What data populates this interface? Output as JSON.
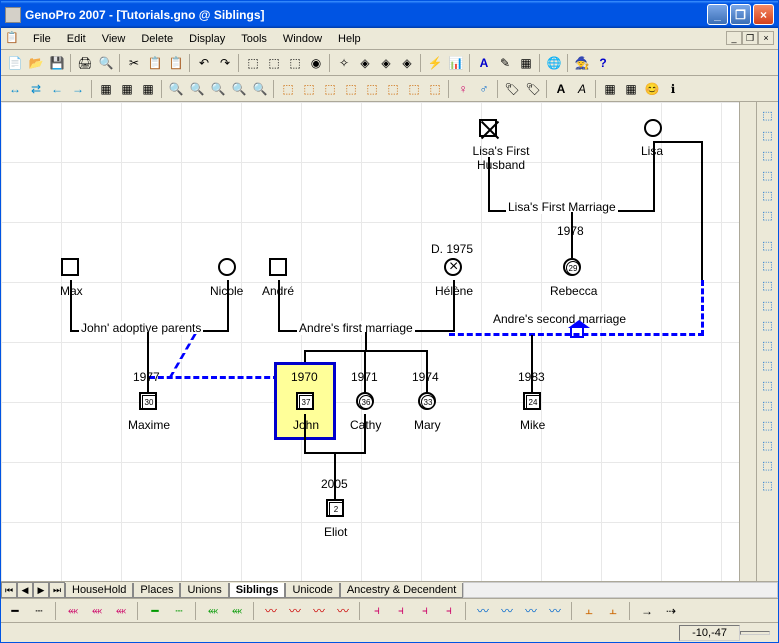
{
  "title": "GenoPro 2007 - [Tutorials.gno @ Siblings]",
  "menu": [
    "File",
    "Edit",
    "View",
    "Delete",
    "Display",
    "Tools",
    "Window",
    "Help"
  ],
  "tabs": {
    "items": [
      "HouseHold",
      "Places",
      "Unions",
      "Siblings",
      "Unicode",
      "Ancestry & Decendent"
    ],
    "active": 3
  },
  "status": {
    "coords": "-10,-47"
  },
  "people": {
    "lisasFirstHusband": {
      "label": "Lisa's First\nHusband"
    },
    "lisa": {
      "label": "Lisa"
    },
    "max": {
      "label": "Max"
    },
    "nicole": {
      "label": "Nicole"
    },
    "andre": {
      "label": "André"
    },
    "helene": {
      "label": "Hélène",
      "death": "D. 1975"
    },
    "rebecca": {
      "label": "Rebecca",
      "age": "29"
    },
    "maxime": {
      "label": "Maxime",
      "age": "30",
      "year": "1977"
    },
    "john": {
      "label": "John",
      "age": "37",
      "year": "1970"
    },
    "cathy": {
      "label": "Cathy",
      "age": "36",
      "year": "1971"
    },
    "mary": {
      "label": "Mary",
      "age": "33",
      "year": "1974"
    },
    "mike": {
      "label": "Mike",
      "age": "24",
      "year": "1983"
    },
    "eliot": {
      "label": "Eliot",
      "age": "2",
      "year": "2005"
    }
  },
  "marriages": {
    "lisasFirst": {
      "label": "Lisa's First Marriage",
      "year": "1978"
    },
    "adoptive": {
      "label": "John' adoptive parents"
    },
    "andresFirst": {
      "label": "Andre's first marriage"
    },
    "andresSecond": {
      "label": "Andre's second marriage"
    }
  }
}
